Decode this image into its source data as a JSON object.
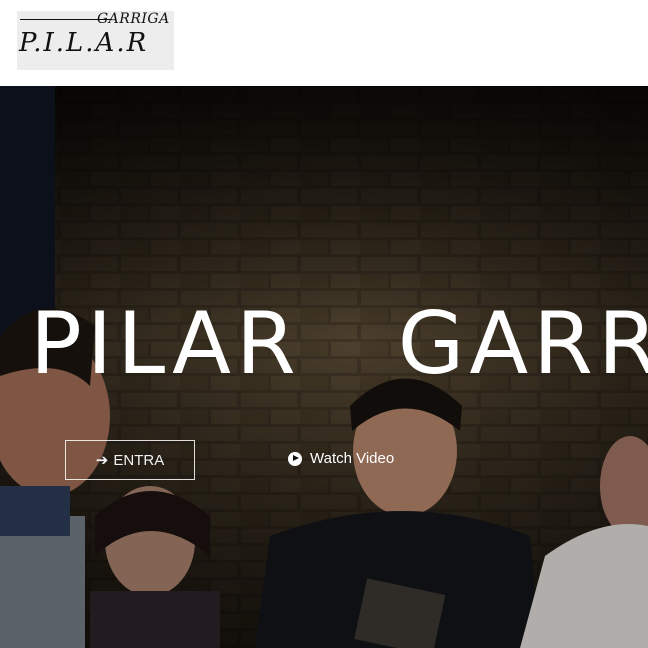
{
  "logo": {
    "top_text": "GARRIGA",
    "main_text": "P.I.L.A.R"
  },
  "hero": {
    "title": "PILAR   GARRIGA",
    "entra_label": "ENTRA",
    "watch_label": "Watch Video"
  },
  "icons": {
    "entra": "arrow-right-icon",
    "watch": "play-circle-icon"
  },
  "colors": {
    "text_light": "#ffffff",
    "header_bg": "#ffffff"
  }
}
